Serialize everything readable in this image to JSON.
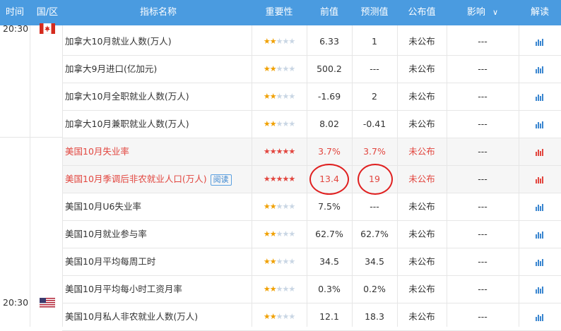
{
  "headers": {
    "time": "时间",
    "country": "国/区",
    "name": "指标名称",
    "importance": "重要性",
    "previous": "前值",
    "forecast": "预测值",
    "actual": "公布值",
    "impact": "影响",
    "interpret": "解读"
  },
  "time_canada": "20:30",
  "time_us": "20:30",
  "rows": [
    {
      "name": "加拿大10月就业人数(万人)",
      "stars": 2,
      "prev": "6.33",
      "fcst": "1",
      "actual": "未公布",
      "impact": "---",
      "highlight": false
    },
    {
      "name": "加拿大9月进口(亿加元)",
      "stars": 2,
      "prev": "500.2",
      "fcst": "---",
      "actual": "未公布",
      "impact": "---",
      "highlight": false
    },
    {
      "name": "加拿大10月全职就业人数(万人)",
      "stars": 2,
      "prev": "-1.69",
      "fcst": "2",
      "actual": "未公布",
      "impact": "---",
      "highlight": false
    },
    {
      "name": "加拿大10月兼职就业人数(万人)",
      "stars": 2,
      "prev": "8.02",
      "fcst": "-0.41",
      "actual": "未公布",
      "impact": "---",
      "highlight": false
    },
    {
      "name": "美国10月失业率",
      "stars": 5,
      "prev": "3.7%",
      "fcst": "3.7%",
      "actual": "未公布",
      "impact": "---",
      "highlight": true
    },
    {
      "name": "美国10月季调后非农就业人口(万人)",
      "stars": 5,
      "prev": "13.4",
      "fcst": "19",
      "actual": "未公布",
      "impact": "---",
      "highlight": true,
      "badge": "阅读"
    },
    {
      "name": "美国10月U6失业率",
      "stars": 2,
      "prev": "7.5%",
      "fcst": "---",
      "actual": "未公布",
      "impact": "---",
      "highlight": false
    },
    {
      "name": "美国10月就业参与率",
      "stars": 2,
      "prev": "62.7%",
      "fcst": "62.7%",
      "actual": "未公布",
      "impact": "---",
      "highlight": false
    },
    {
      "name": "美国10月平均每周工时",
      "stars": 2,
      "prev": "34.5",
      "fcst": "34.5",
      "actual": "未公布",
      "impact": "---",
      "highlight": false
    },
    {
      "name": "美国10月平均每小时工资月率",
      "stars": 2,
      "prev": "0.3%",
      "fcst": "0.2%",
      "actual": "未公布",
      "impact": "---",
      "highlight": false
    },
    {
      "name": "美国10月私人非农就业人数(万人)",
      "stars": 2,
      "prev": "12.1",
      "fcst": "18.3",
      "actual": "未公布",
      "impact": "---",
      "highlight": false
    }
  ],
  "colors": {
    "header": "#4a9be0",
    "highlight": "#e2463f",
    "star": "#f0a000",
    "chart_icon": "#3a86d0"
  }
}
